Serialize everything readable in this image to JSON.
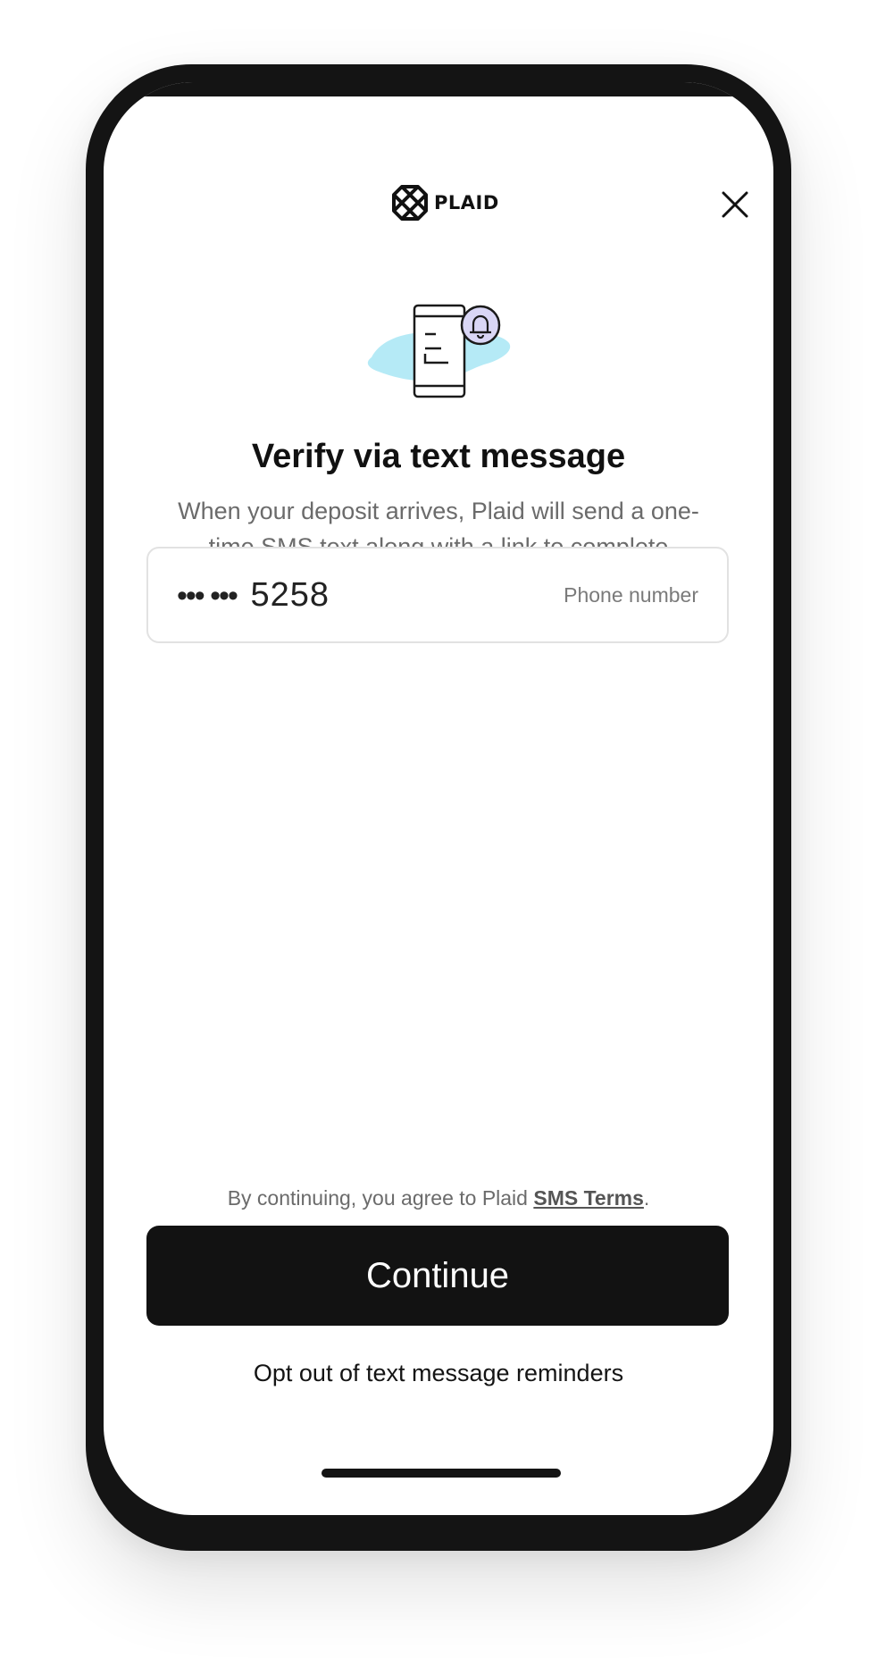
{
  "header": {
    "logo_text": "PLAID",
    "close_icon": "close-icon"
  },
  "illustration": {
    "icon": "phone-notification-illustration",
    "accent_color": "#a8e6f5",
    "bell_color": "#d9d6f5"
  },
  "content": {
    "title": "Verify via text message",
    "description": "When your deposit arrives, Plaid will send a one-time SMS text along with a link to complete verification."
  },
  "phone_field": {
    "masked_prefix": "••• •••",
    "value": "5258",
    "label": "Phone number"
  },
  "terms": {
    "prefix": "By continuing, you agree to Plaid ",
    "link_text": "SMS Terms",
    "suffix": "."
  },
  "actions": {
    "continue_label": "Continue",
    "opt_out_label": "Opt out of text message reminders"
  },
  "colors": {
    "primary_button": "#121212",
    "frame": "#141414",
    "text_muted": "#6b6b6b"
  }
}
